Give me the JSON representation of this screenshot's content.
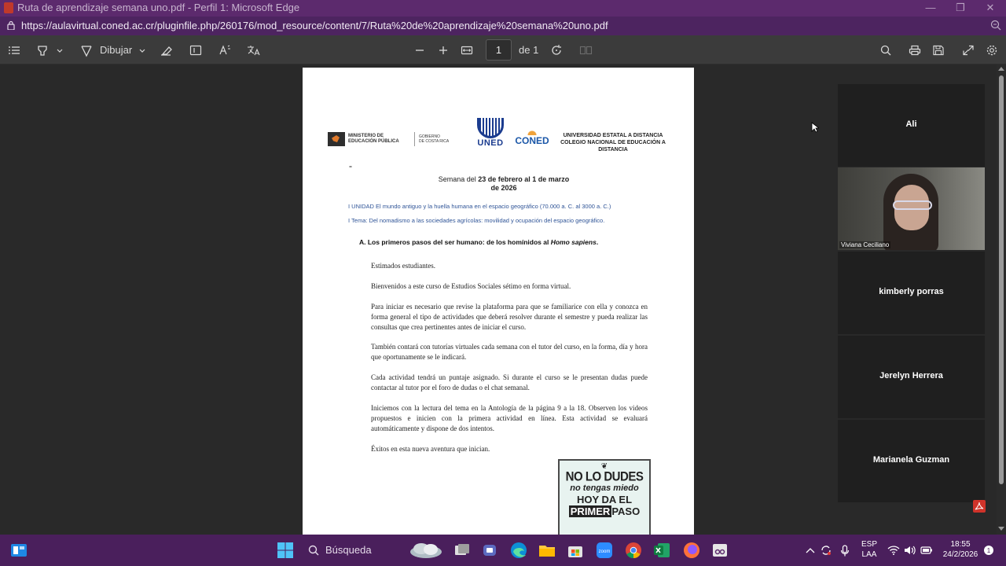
{
  "window": {
    "title": "Ruta de aprendizaje semana uno.pdf - Perfil 1: Microsoft Edge",
    "minimize": "—",
    "restore": "❐",
    "close": "✕"
  },
  "address": {
    "url": "https://aulavirtual.coned.ac.cr/pluginfile.php/260176/mod_resource/content/7/Ruta%20de%20aprendizaje%20semana%20uno.pdf"
  },
  "toolbar": {
    "draw_label": "Dibujar",
    "page_number": "1",
    "page_total": "de 1"
  },
  "document": {
    "ministry_line1": "MINISTERIO DE",
    "ministry_line2": "EDUCACIÓN PÚBLICA",
    "gov_line1": "GOBIERNO",
    "gov_line2": "DE COSTA RICA",
    "uned": "UNED",
    "coned": "CONED",
    "university": "UNIVERSIDAD ESTATAL A DISTANCIA COLEGIO NACIONAL DE EDUCACIÓN A DISTANCIA",
    "dash": "-",
    "week_prefix": "Semana del ",
    "week_bold": "23 de febrero al 1 de marzo",
    "week_year": "de 2026",
    "unidad": "I UNIDAD   El mundo antiguo y la huella humana en el espacio geográfico (70.000 a. C. al 3000 a. C.)",
    "tema": "I Tema:  Del nomadismo a las sociedades agrícolas: movilidad y ocupación del espacio geográfico.",
    "section_a": "A. Los primeros pasos del ser humano: de los homínidos al ",
    "section_a_italic": "Homo sapiens",
    "section_a_end": ".",
    "paragraphs": [
      "Estimados estudiantes.",
      "Bienvenidos a este curso de Estudios Sociales sétimo en forma virtual.",
      "Para iniciar es necesario que revise la plataforma para que se familiarice con ella y conozca en forma general el tipo de actividades que deberá resolver durante el semestre y pueda realizar las consultas que crea pertinentes antes de iniciar el curso.",
      "También contará con tutorías virtuales cada semana con el tutor del curso, en la forma, día y hora que oportunamente se le indicará.",
      "Cada actividad tendrá un puntaje asignado. Si durante el curso se le presentan dudas puede contactar al tutor por el foro de dudas o el chat semanal.",
      "Iniciemos con la lectura del tema en la Antología de la página 9 a la 18. Observen los videos propuestos e inicien con la primera actividad en línea.   Esta actividad se evaluará automáticamente y dispone de dos intentos.",
      "Éxitos en esta nueva aventura que inician."
    ],
    "poster": {
      "line1": "NO LO DUDES",
      "line2": "no tengas miedo",
      "line3": "HOY DA EL",
      "line4a": "PRIMER",
      "line4b": "PASO"
    }
  },
  "participants": [
    {
      "name": "Ali",
      "video": false
    },
    {
      "name": "Viviana Ceciliano",
      "video": true
    },
    {
      "name": "kimberly porras",
      "video": false
    },
    {
      "name": "Jerelyn Herrera",
      "video": false
    },
    {
      "name": "Marianela Guzman",
      "video": false
    }
  ],
  "taskbar": {
    "search_label": "Búsqueda",
    "lang1": "ESP",
    "lang2": "LAA",
    "time": "18:55",
    "date": "24/2/2026"
  },
  "colors": {
    "titlebar": "#5c2a6d",
    "addressbar": "#4d2460",
    "taskbar": "#4a1f5c",
    "toolbar": "#3b3b3b",
    "viewer": "#292929",
    "doc_blue": "#2f5497"
  }
}
